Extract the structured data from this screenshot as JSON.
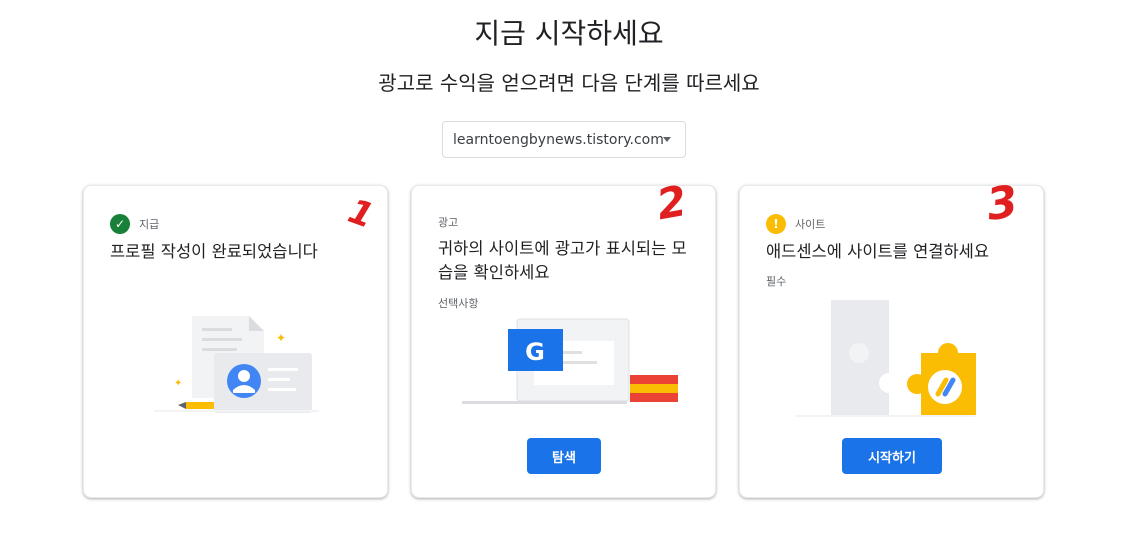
{
  "header": {
    "title": "지금 시작하세요",
    "subtitle": "광고로 수익을 얻으려면 다음 단계를 따르세요"
  },
  "site_selector": {
    "selected": "learntoengbynews.tistory.com"
  },
  "cards": [
    {
      "tag": "지급",
      "status_icon": "check-icon",
      "heading": "프로필 작성이 완료되었습니다",
      "annotation": "1"
    },
    {
      "tag": "광고",
      "heading": "귀하의 사이트에 광고가 표시되는 모습을 확인하세요",
      "sub": "선택사항",
      "button": "탐색",
      "annotation": "2"
    },
    {
      "tag": "사이트",
      "status_icon": "warning-icon",
      "heading": "애드센스에 사이트를 연결하세요",
      "sub": "필수",
      "button": "시작하기",
      "annotation": "3"
    }
  ],
  "colors": {
    "primary": "#1a73e8",
    "success": "#188038",
    "warning": "#fbbc04",
    "annotation": "#e02020"
  }
}
